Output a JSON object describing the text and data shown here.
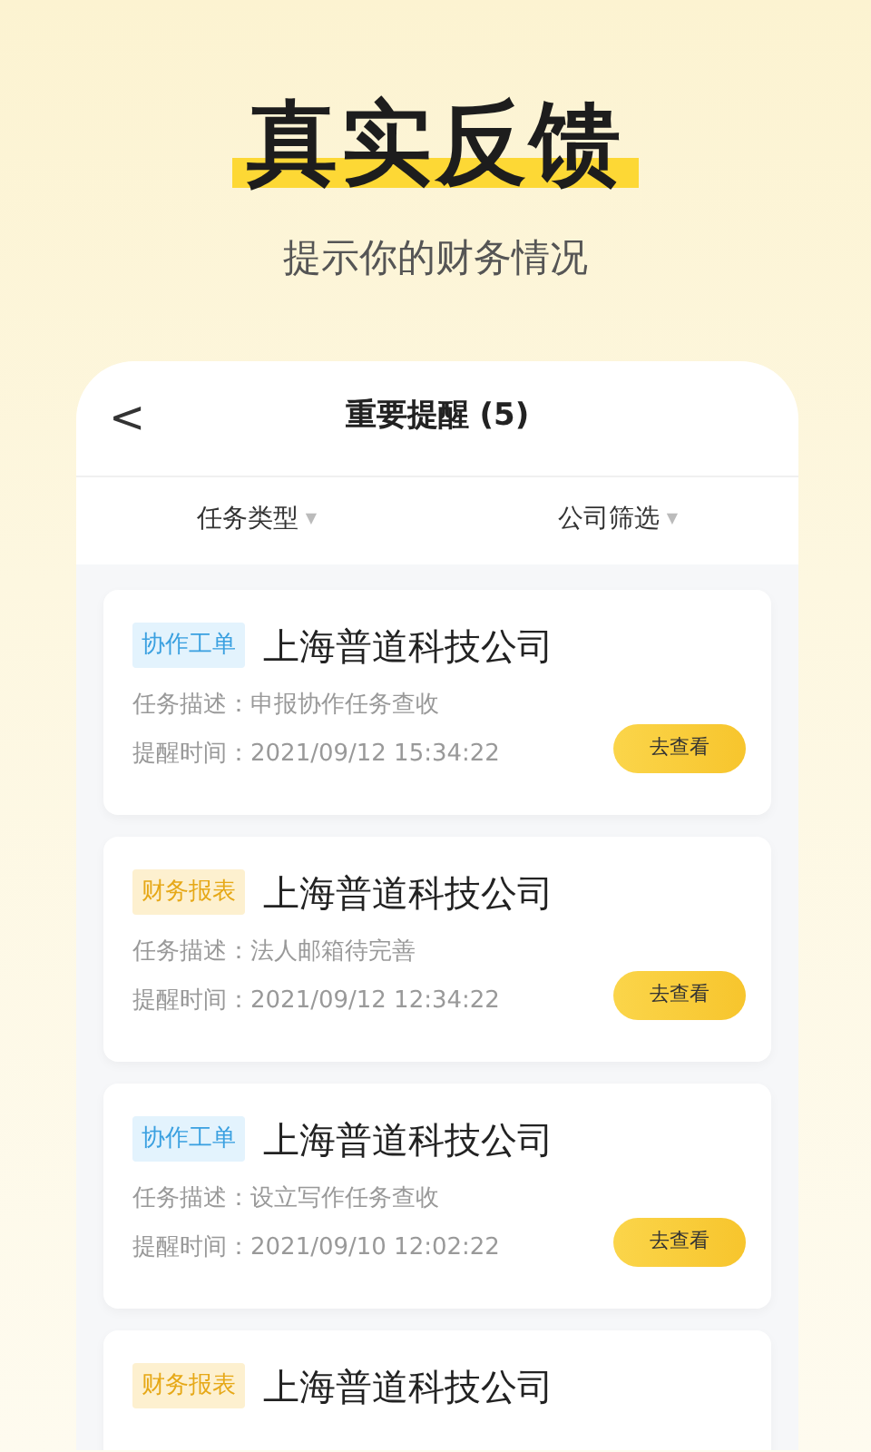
{
  "headline": "真实反馈",
  "subtitle": "提示你的财务情况",
  "nav": {
    "back": "<",
    "title": "重要提醒 (5)"
  },
  "filters": [
    {
      "label": "任务类型",
      "arrow": "▼"
    },
    {
      "label": "公司筛选",
      "arrow": "▼"
    }
  ],
  "reminders": [
    {
      "tag": "协作工单",
      "kind": "collab",
      "company": "上海普道科技公司",
      "desc_label": "任务描述：",
      "desc": "申报协作任务查收",
      "time_label": "提醒时间：",
      "time": "2021/09/12 15:34:22",
      "button": "去查看"
    },
    {
      "tag": "财务报表",
      "kind": "finance",
      "company": "上海普道科技公司",
      "desc_label": "任务描述：",
      "desc": "法人邮箱待完善",
      "time_label": "提醒时间：",
      "time": "2021/09/12 12:34:22",
      "button": "去查看"
    },
    {
      "tag": "协作工单",
      "kind": "collab",
      "company": "上海普道科技公司",
      "desc_label": "任务描述：",
      "desc": "设立写作任务查收",
      "time_label": "提醒时间：",
      "time": "2021/09/10 12:02:22",
      "button": "去查看"
    },
    {
      "tag": "财务报表",
      "kind": "finance",
      "company": "上海普道科技公司"
    }
  ]
}
